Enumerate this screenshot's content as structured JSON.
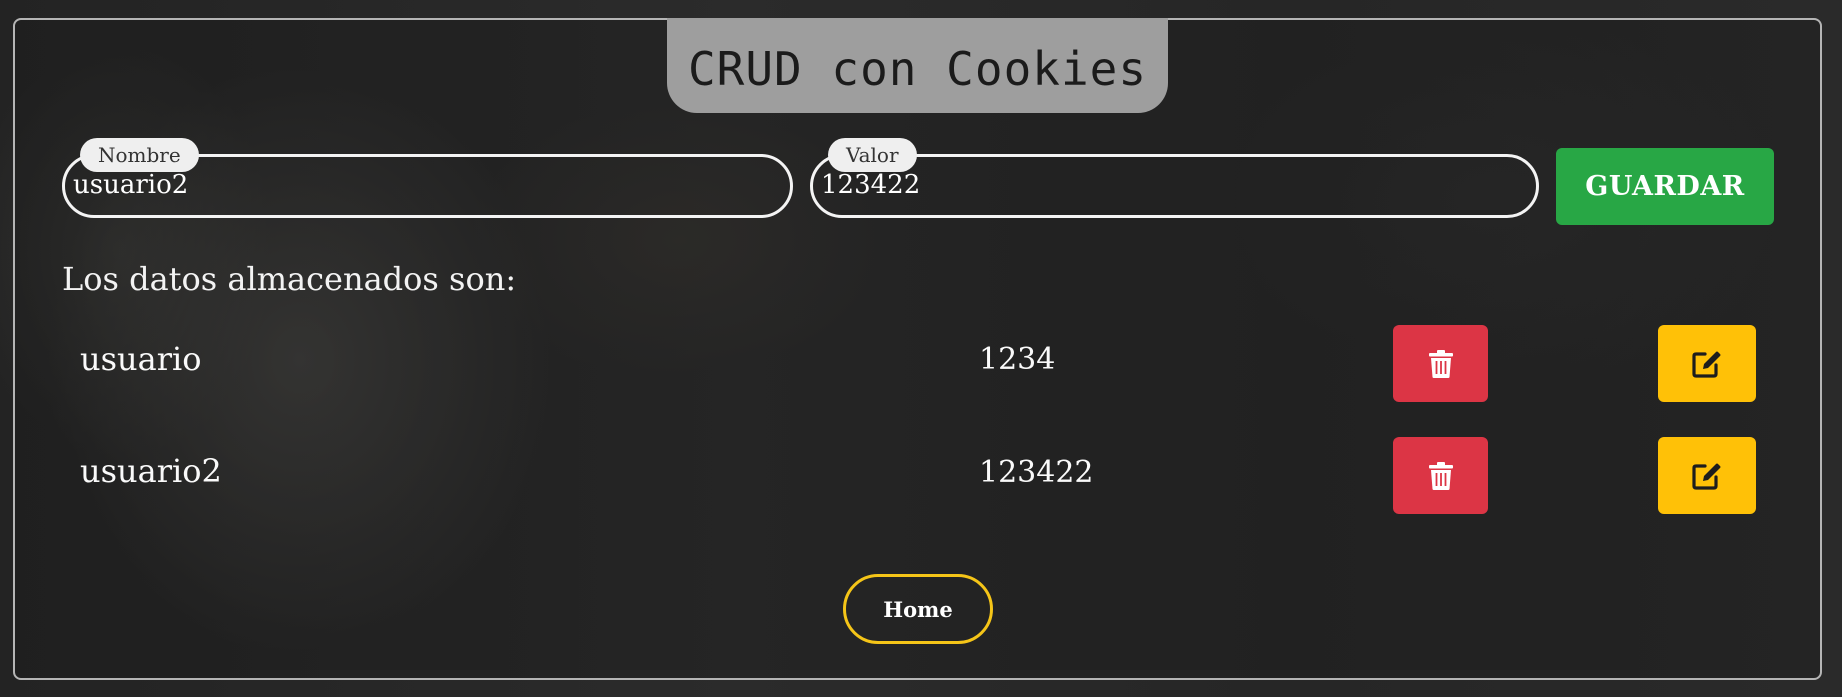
{
  "header": {
    "title": "CRUD con Cookies"
  },
  "form": {
    "nombre": {
      "label": "Nombre",
      "value": "usuario2"
    },
    "valor": {
      "label": "Valor",
      "value": "123422"
    },
    "save_label": "GUARDAR"
  },
  "list": {
    "heading": "Los datos almacenados son:",
    "rows": [
      {
        "name": "usuario",
        "value": "1234"
      },
      {
        "name": "usuario2",
        "value": "123422"
      }
    ]
  },
  "icons": {
    "delete": "trash-icon",
    "edit": "edit-icon"
  },
  "colors": {
    "save": "#28a745",
    "delete": "#dc3545",
    "edit": "#ffc107",
    "home_border": "#f5c518",
    "title_bg": "#9e9e9e"
  },
  "footer": {
    "home_label": "Home"
  }
}
